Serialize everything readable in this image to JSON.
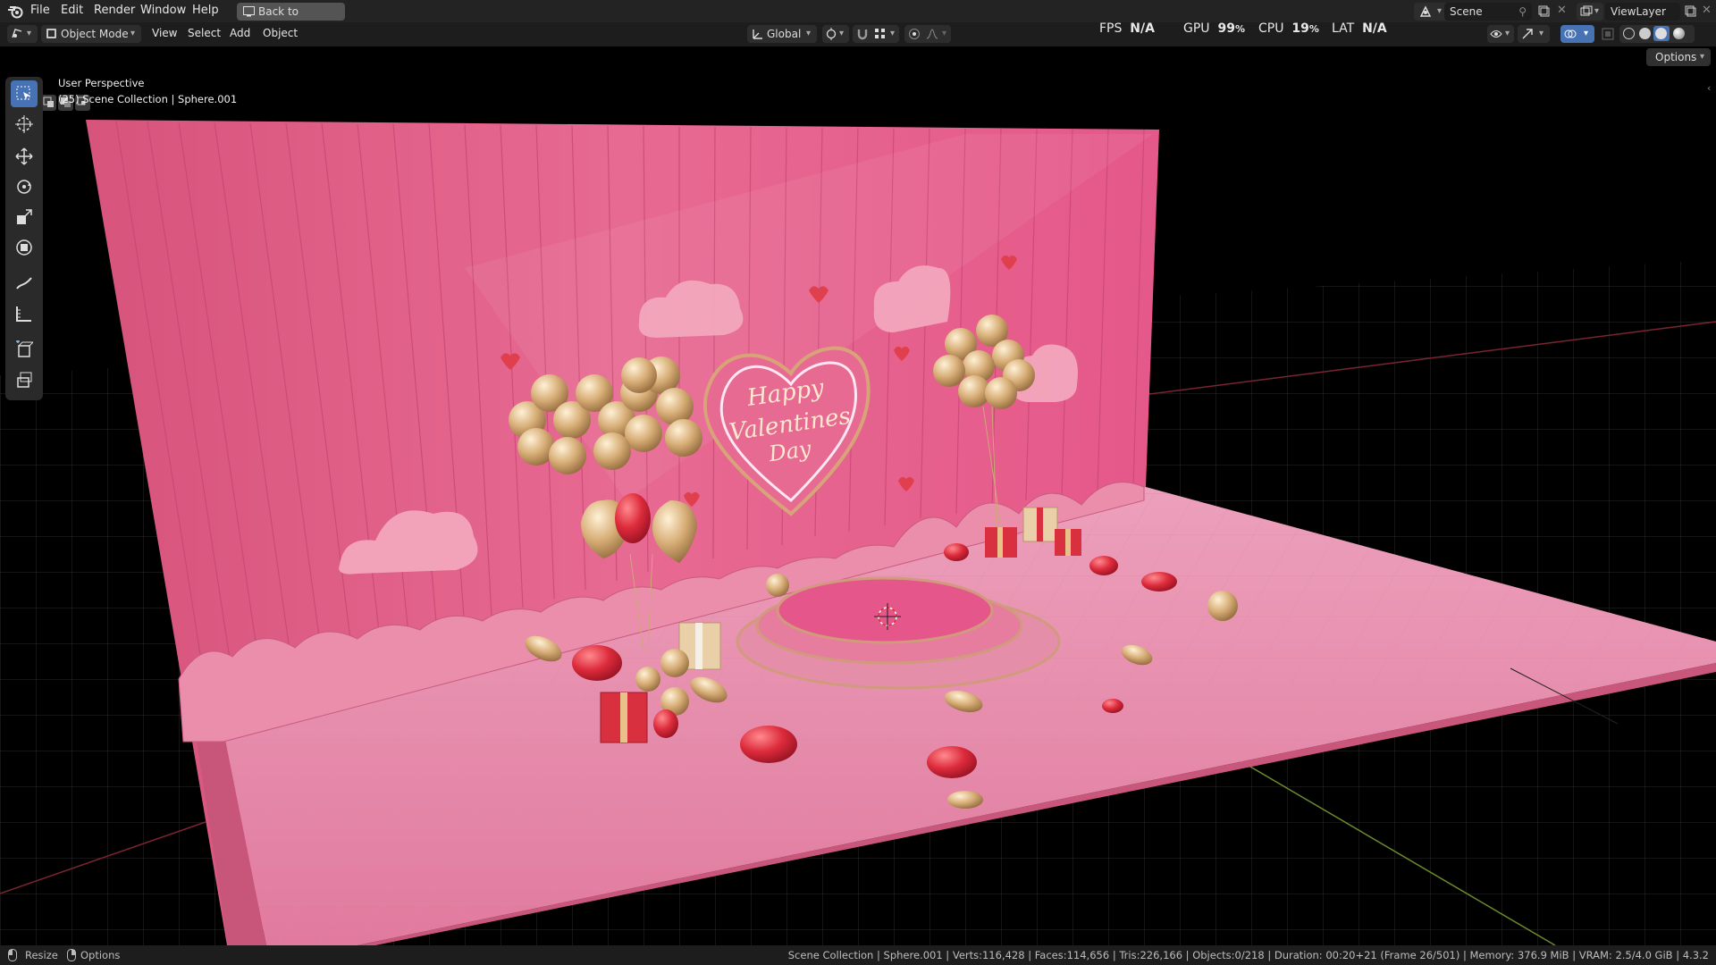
{
  "topbar": {
    "menus": [
      "File",
      "Edit",
      "Render",
      "Window",
      "Help"
    ],
    "back_button": "Back to Previous",
    "scene": "Scene",
    "view_layer": "ViewLayer"
  },
  "header": {
    "mode": "Object Mode",
    "menus": [
      "View",
      "Select",
      "Add",
      "Object"
    ],
    "orientation": "Global",
    "options": "Options"
  },
  "perf": {
    "fps_label": "FPS",
    "fps_value": "N/A",
    "gpu_label": "GPU",
    "gpu_value": "99",
    "cpu_label": "CPU",
    "cpu_value": "19",
    "lat_label": "LAT",
    "lat_value": "N/A",
    "percent": "%"
  },
  "viewport": {
    "perspective": "User Perspective",
    "collection": "(25) Scene Collection | Sphere.001",
    "sign_text": [
      "Happy",
      "Valentines",
      "Day"
    ]
  },
  "toolbar": {
    "tools": [
      "select-box-icon",
      "cursor-icon",
      "move-icon",
      "rotate-icon",
      "scale-icon",
      "transform-icon",
      "annotate-icon",
      "measure-icon",
      "add-cube-icon",
      "extrude-icon"
    ]
  },
  "status": {
    "left_a": "Resize",
    "left_b": "Options",
    "info": "Scene Collection | Sphere.001 | Verts:116,428 | Faces:114,656 | Tris:226,166 | Objects:0/218 | Duration: 00:20+21 (Frame 26/501) | Memory: 376.9 MiB | VRAM: 2.5/4.0 GiB | 4.3.2"
  },
  "colors": {
    "accent": "#4772b3",
    "wall": "#e06a8e",
    "floor": "#e991ad",
    "gold": "#d8b27a",
    "heart_red": "#d8303f"
  }
}
